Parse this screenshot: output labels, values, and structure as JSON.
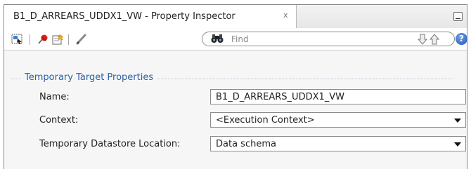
{
  "tab": {
    "title": "B1_D_ARREARS_UDDX1_VW - Property Inspector",
    "close_glyph": "x"
  },
  "toolbar": {
    "icons": [
      "select-node-icon",
      "pin-icon",
      "edit-properties-icon",
      "pencil-icon"
    ],
    "search_placeholder": "Find",
    "help_label": "?"
  },
  "group": {
    "title": "Temporary Target Properties"
  },
  "fields": [
    {
      "label": "Name:",
      "value": "B1_D_ARREARS_UDDX1_VW",
      "kind": "text"
    },
    {
      "label": "Context:",
      "value": "<Execution Context>",
      "kind": "select"
    },
    {
      "label": "Temporary Datastore Location:",
      "value": "Data schema",
      "kind": "select"
    }
  ],
  "colors": {
    "group_title": "#2b62a6",
    "panel_background": "#f6f6f6"
  }
}
